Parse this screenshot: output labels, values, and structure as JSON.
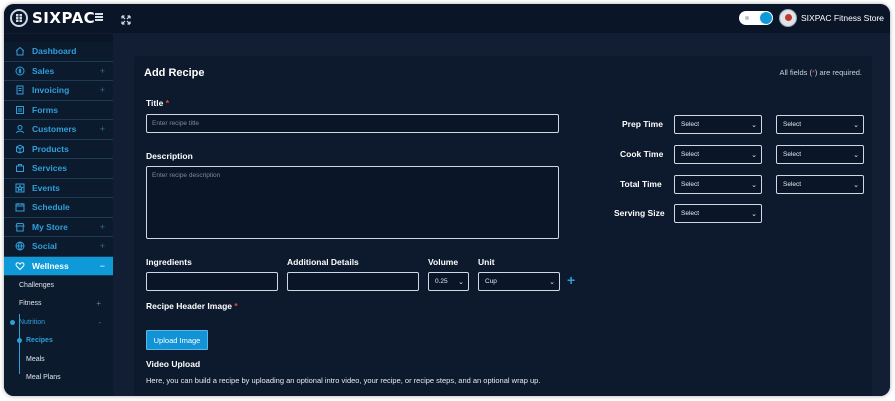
{
  "topbar": {
    "logo_text": "SIXPAC",
    "store_name": "SIXPAC Fitness Store"
  },
  "sidebar": {
    "items": [
      {
        "label": "Dashboard",
        "icon": "home-icon",
        "plus": ""
      },
      {
        "label": "Sales",
        "icon": "dollar-icon",
        "plus": "+"
      },
      {
        "label": "Invoicing",
        "icon": "invoice-icon",
        "plus": "+"
      },
      {
        "label": "Forms",
        "icon": "forms-icon",
        "plus": ""
      },
      {
        "label": "Customers",
        "icon": "user-icon",
        "plus": "+"
      },
      {
        "label": "Products",
        "icon": "box-icon",
        "plus": ""
      },
      {
        "label": "Services",
        "icon": "services-icon",
        "plus": ""
      },
      {
        "label": "Events",
        "icon": "star-icon",
        "plus": ""
      },
      {
        "label": "Schedule",
        "icon": "calendar-icon",
        "plus": ""
      },
      {
        "label": "My Store",
        "icon": "store-icon",
        "plus": "+"
      },
      {
        "label": "Social",
        "icon": "globe-icon",
        "plus": "+"
      },
      {
        "label": "Wellness",
        "icon": "heart-icon",
        "plus": "−"
      }
    ],
    "wellness_sub": {
      "challenges": "Challenges",
      "fitness": "Fitness",
      "fitness_plus": "+",
      "nutrition": "Nutrition",
      "nutrition_minus": "-",
      "recipes": "Recipes",
      "meals": "Meals",
      "meal_plans": "Meal Plans"
    }
  },
  "form": {
    "title": "Add Recipe",
    "required_note_prefix": "All fields (",
    "required_star": "*",
    "required_note_suffix": ") are required.",
    "title_label": "Title",
    "title_placeholder": "Enter recipe title",
    "description_label": "Description",
    "description_placeholder": "Enter recipe description",
    "ingredients_label": "Ingredients",
    "additional_label": "Additional Details",
    "volume_label": "Volume",
    "volume_value": "0.25",
    "unit_label": "Unit",
    "unit_value": "Cup",
    "add_symbol": "+",
    "header_image_label": "Recipe Header Image",
    "upload_button": "Upload Image",
    "video_label": "Video Upload",
    "video_text": "Here, you can build a recipe by uploading an optional intro video, your recipe, or recipe steps, and an optional wrap up.",
    "prep_label": "Prep Time",
    "cook_label": "Cook Time",
    "total_label": "Total Time",
    "serving_label": "Serving Size",
    "select_text": "Select"
  }
}
